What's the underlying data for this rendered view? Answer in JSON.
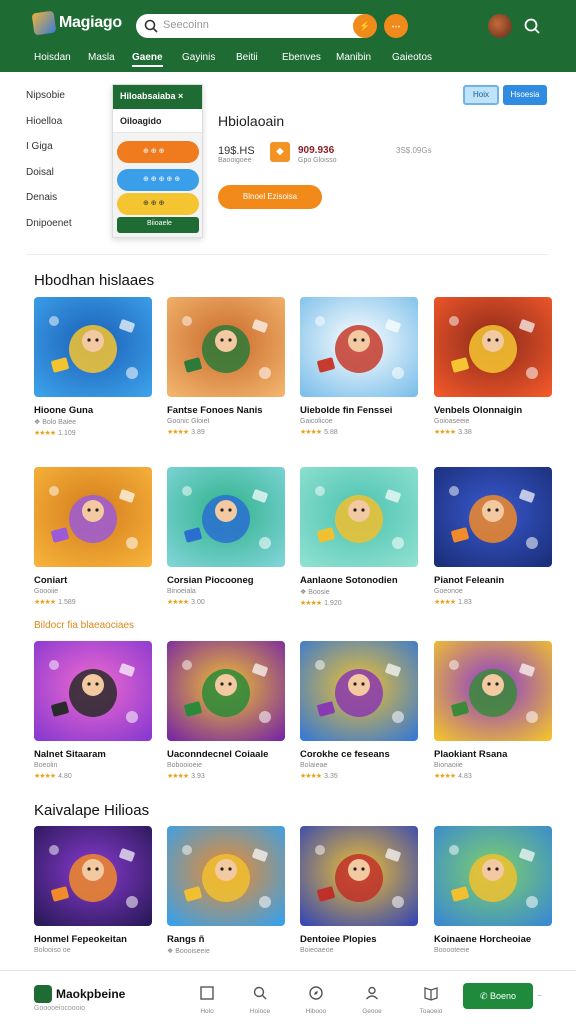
{
  "app": {
    "logo": "Magiago"
  },
  "header": {
    "search_placeholder": "Seecoinn",
    "btn1": "⚡",
    "btn2": "⋯",
    "nav": [
      "Hoisdan",
      "Masla",
      "Gaene",
      "Gayinis",
      "Beitii",
      "Ebenves",
      "Manibin",
      "Gaieotos"
    ],
    "active_nav": 2
  },
  "left_menu": [
    "Nipsobie",
    "Hioelloa",
    "I Giga",
    "Doisal",
    "Denais",
    "Dnipoenet"
  ],
  "dropdown": {
    "header": "Hiloabsaiaba ×",
    "sub": "Oiloagido",
    "row1": "⊕ ⊕ ⊕",
    "row2": "⊕ ⊕ ⊕ ⊕ ⊕",
    "row3": "⊕ ⊕ ⊕",
    "footer": "Biioaele",
    "colors": {
      "row1": "#f07a1e",
      "row2": "#3a9ee8",
      "row3": "#f5c531"
    }
  },
  "feature": {
    "title": "Hbiolaoain",
    "price1": "19$.HS",
    "sub1": "Baooigoee",
    "price2": "909.936",
    "sub2": "Gpo Gloisso",
    "meta": "3S$.09Gs",
    "button": "Blnoel Ezisoisa",
    "tab1": "Hoix",
    "tab2": "Hsoesia"
  },
  "sections": [
    {
      "title": "Hbodhan hislaaes",
      "cards": [
        {
          "name": "Hioone Guna",
          "sub": "❖ Bolo Baiee",
          "rating": "1.109",
          "art": "solse"
        },
        {
          "name": "Fantse Fonoes Nanis",
          "sub": "Goonic Gloiet",
          "rating": "3.89",
          "art": "tablet"
        },
        {
          "name": "Uiebolde fin Fenssei",
          "sub": "Gaicolicoe",
          "rating": "5.88",
          "art": "ninja"
        },
        {
          "name": "Venbels Olonnaigin",
          "sub": "Goioaseeie",
          "rating": "3.38",
          "art": "crab"
        }
      ]
    },
    {
      "title": "",
      "cards": [
        {
          "name": "Coniart",
          "sub": "Goooiie",
          "rating": "1.589",
          "art": "board"
        },
        {
          "name": "Corsian Piocooneg",
          "sub": "Binoeiala",
          "rating": "3.00",
          "art": "pad"
        },
        {
          "name": "Aanlaone Sotonodien",
          "sub": "❖ Boosie",
          "rating": "1.920",
          "art": "boon"
        },
        {
          "name": "Pianot Feleanin",
          "sub": "Goeonoe",
          "rating": "1.83",
          "art": "space"
        }
      ]
    },
    {
      "title": "Bildocr fia blaeaociaes",
      "cards": [
        {
          "name": "Nalnet Sitaaram",
          "sub": "Boeolin",
          "rating": "4.80",
          "art": "robot"
        },
        {
          "name": "Uaconndecnel Coiaale",
          "sub": "Bobooioeie",
          "rating": "3.93",
          "art": "goblin"
        },
        {
          "name": "Corokhe ce feseans",
          "sub": "Bolaieae",
          "rating": "3.35",
          "art": "youn"
        },
        {
          "name": "Plaokiant Rsana",
          "sub": "Bionaoiie",
          "rating": "4.83",
          "art": "gutan"
        }
      ]
    },
    {
      "title": "Kaivalape Hilioas",
      "cards": [
        {
          "name": "Honmel Fepeokeitan",
          "sub": "Bolooiso oe",
          "rating": "",
          "art": "hero"
        },
        {
          "name": "Rangs ñ",
          "sub": "❖ Boooiseeie",
          "rating": "",
          "art": "amie"
        },
        {
          "name": "Dentoiee Plopies",
          "sub": "Boieoaeoe",
          "rating": "",
          "art": "frean"
        },
        {
          "name": "Koinaene Horcheoiae",
          "sub": "Booooteeie",
          "rating": "",
          "art": "iunas"
        }
      ]
    }
  ],
  "bottom": {
    "brand": "Maokpbeine",
    "brand_sub": "Gooooeiocoooio",
    "nav": [
      "Holo",
      "Hoioce",
      "Hibooo",
      "Geooe",
      "Toaoeio"
    ],
    "button": "Boeno",
    "dot": "−"
  },
  "colors": {
    "brand_green": "#1f6b34",
    "accent_orange": "#f28a19",
    "link_blue": "#2f8ce0"
  }
}
